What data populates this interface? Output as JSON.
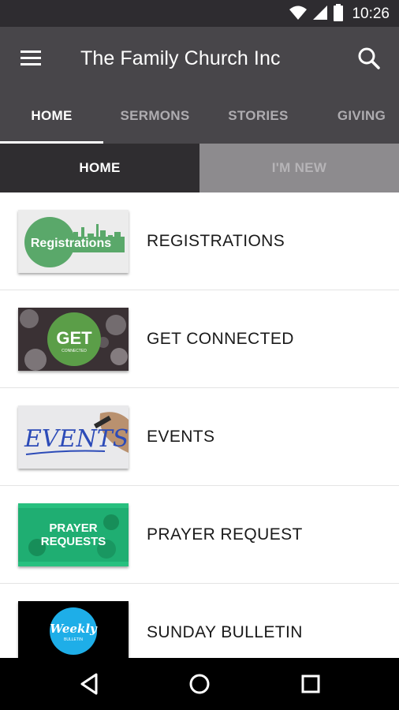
{
  "status_bar": {
    "time": "10:26",
    "icons": [
      "wifi-icon",
      "cell-signal-icon",
      "battery-icon"
    ]
  },
  "app_bar": {
    "title": "The Family Church Inc",
    "menu_icon": "hamburger-menu-icon",
    "search_icon": "search-icon"
  },
  "tabs": [
    {
      "label": "HOME",
      "active": true
    },
    {
      "label": "SERMONS",
      "active": false
    },
    {
      "label": "STORIES",
      "active": false
    },
    {
      "label": "GIVING",
      "active": false
    }
  ],
  "subtabs": [
    {
      "label": "HOME",
      "active": true
    },
    {
      "label": "I'M NEW",
      "active": false
    }
  ],
  "list": [
    {
      "label": "REGISTRATIONS",
      "thumb_text": "Registrations"
    },
    {
      "label": "GET CONNECTED",
      "thumb_text": "GET",
      "thumb_subtext": "CONNECTED"
    },
    {
      "label": "EVENTS",
      "thumb_text": "EVENTS"
    },
    {
      "label": "PRAYER REQUEST",
      "thumb_text": "PRAYER",
      "thumb_text2": "REQUESTS"
    },
    {
      "label": "SUNDAY BULLETIN",
      "thumb_text": "Weekly",
      "thumb_subtext": "BULLETIN"
    }
  ],
  "nav_bar": {
    "icons": [
      "back-icon",
      "home-icon",
      "recents-icon"
    ]
  },
  "colors": {
    "status_bar": "#2e2c30",
    "app_bar": "#48464a",
    "subtab_active": "#2f2d30",
    "subtab_inactive": "#8d8b8e",
    "registrations_green": "#5aa86a",
    "prayer_green": "#1fae72",
    "bulletin_blue": "#1eaee8"
  }
}
